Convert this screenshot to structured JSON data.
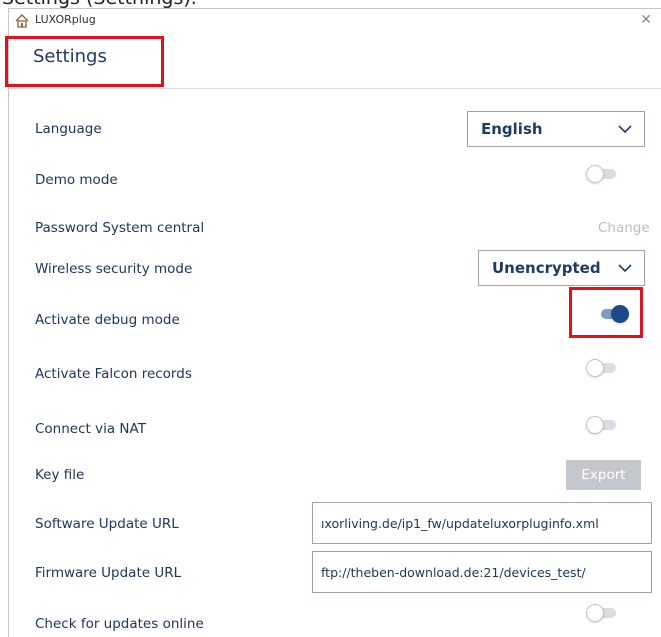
{
  "caption": "Settings (Setthings).",
  "window": {
    "title": "LUXORplug",
    "close_glyph": "✕"
  },
  "settings": {
    "title": "Settings"
  },
  "rows": {
    "language": {
      "label": "Language",
      "value": "English"
    },
    "demo_mode": {
      "label": "Demo mode",
      "on": false
    },
    "password": {
      "label": "Password System central",
      "action": "Change"
    },
    "wireless": {
      "label": "Wireless security mode",
      "value": "Unencrypted"
    },
    "debug": {
      "label": "Activate debug mode",
      "on": true
    },
    "falcon": {
      "label": "Activate Falcon records",
      "on": false
    },
    "nat": {
      "label": "Connect via NAT",
      "on": false
    },
    "key_file": {
      "label": "Key file",
      "action": "Export"
    },
    "software_url": {
      "label": "Software Update URL",
      "value": "ıxorliving.de/ip1_fw/updateluxorpluginfo.xml"
    },
    "firmware_url": {
      "label": "Firmware Update URL",
      "value": "ftp://theben-download.de:21/devices_test/"
    },
    "check_updates": {
      "label": "Check for updates online",
      "on": false
    }
  },
  "icons": {
    "app": "luxorplug-app-icon",
    "close": "close-icon",
    "dropdown": "chevron-down-icon"
  },
  "colors": {
    "accent": "#1a4a8c",
    "label_text": "#1d3557",
    "highlight": "#e3101f",
    "disabled": "#c4c8cd"
  }
}
